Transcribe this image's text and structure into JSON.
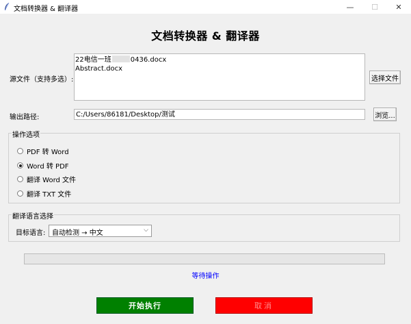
{
  "window": {
    "title": "文档转换器 & 翻译器",
    "minimize": "—",
    "maximize": "☐",
    "close": "✕"
  },
  "heading": "文档转换器 & 翻译器",
  "source": {
    "label": "源文件（支持多选）:",
    "files": [
      {
        "before": "22电信一班",
        "after": "0436.docx"
      },
      {
        "before": "Abstract.docx",
        "after": ""
      }
    ],
    "choose_button": "选择文件"
  },
  "output": {
    "label": "输出路径:",
    "value": "C:/Users/86181/Desktop/测试",
    "browse_button": "浏览..."
  },
  "operations": {
    "title": "操作选项",
    "options": [
      {
        "label": "PDF 转 Word",
        "selected": false
      },
      {
        "label": "Word 转 PDF",
        "selected": true
      },
      {
        "label": "翻译 Word 文件",
        "selected": false
      },
      {
        "label": "翻译 TXT 文件",
        "selected": false
      }
    ]
  },
  "translation": {
    "title": "翻译语言选择",
    "target_label": "目标语言:",
    "target_value": "自动检测 → 中文",
    "chevron_icon": "chevron-down-icon"
  },
  "progress": {
    "fraction": 0
  },
  "status": "等待操作",
  "actions": {
    "start": "开始执行",
    "cancel": "取消"
  },
  "colors": {
    "start_bg": "#008000",
    "cancel_bg": "#ff0000",
    "status_text": "#0000ff"
  }
}
